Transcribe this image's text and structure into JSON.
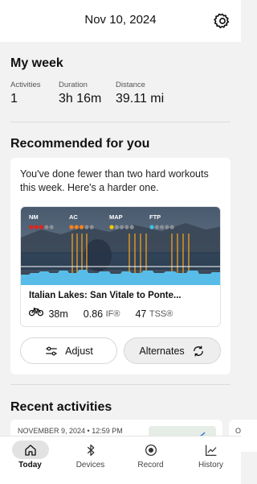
{
  "header": {
    "date": "Nov 10, 2024",
    "settings_icon": "gear-icon"
  },
  "my_week": {
    "title": "My week",
    "stats": [
      {
        "label": "Activities",
        "value": "1"
      },
      {
        "label": "Duration",
        "value": "3h 16m"
      },
      {
        "label": "Distance",
        "value": "39.11 mi"
      }
    ]
  },
  "recommended": {
    "title": "Recommended for you",
    "message": "You've done fewer than two hard workouts this week. Here's a harder one.",
    "workout": {
      "title": "Italian Lakes: San Vitale to Ponte...",
      "duration": "38m",
      "intensity_factor": "0.86",
      "if_label": "IF®",
      "tss": "47",
      "tss_label": "TSS®",
      "ratings": [
        {
          "label": "NM",
          "filled": 3,
          "total": 5,
          "color": "#e2231a"
        },
        {
          "label": "AC",
          "filled": 3,
          "total": 5,
          "color": "#f58220"
        },
        {
          "label": "MAP",
          "filled": 1,
          "total": 5,
          "color": "#f7c600"
        },
        {
          "label": "FTP",
          "filled": 1,
          "total": 5,
          "color": "#3fc1e6"
        }
      ],
      "interval_color": "#f0a020",
      "profile_color": "#57bde8"
    },
    "adjust_label": "Adjust",
    "alternates_label": "Alternates"
  },
  "recent": {
    "title": "Recent activities",
    "items": [
      {
        "date": "NOVEMBER 9, 2024 • 12:59 PM"
      },
      {
        "date": "O"
      }
    ]
  },
  "tabs": [
    {
      "label": "Today",
      "icon": "home-icon",
      "active": true
    },
    {
      "label": "Devices",
      "icon": "bluetooth-icon",
      "active": false
    },
    {
      "label": "Record",
      "icon": "record-icon",
      "active": false
    },
    {
      "label": "History",
      "icon": "chart-icon",
      "active": false
    }
  ]
}
